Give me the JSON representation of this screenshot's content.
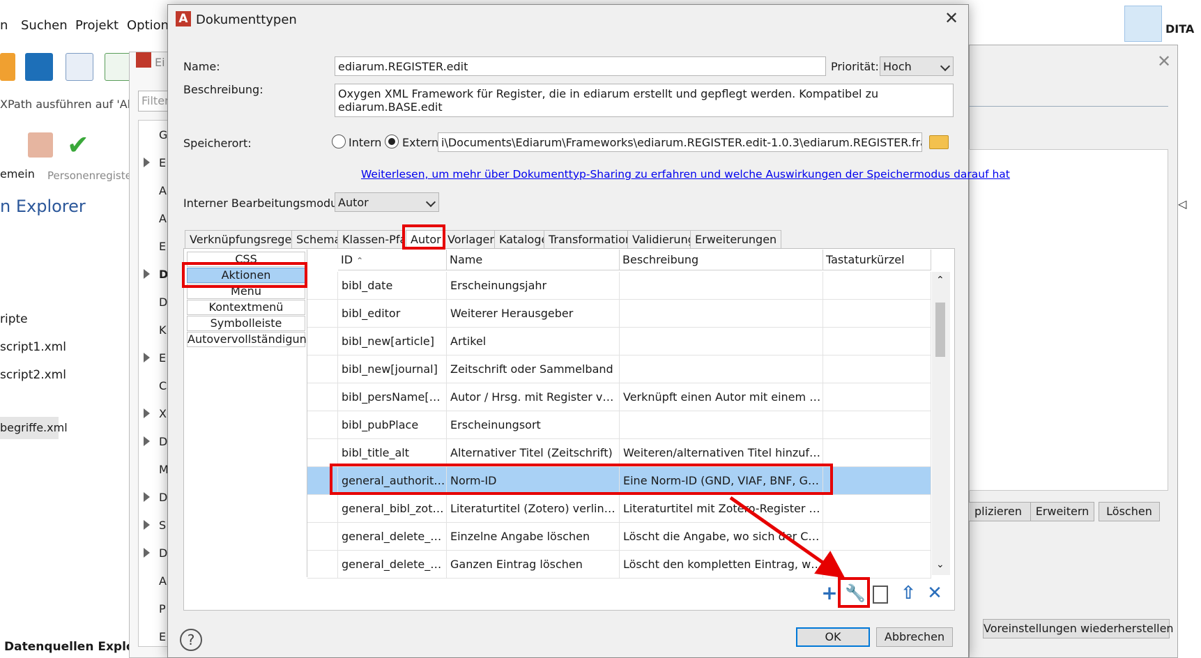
{
  "background_app": {
    "menu": [
      "n",
      "Suchen",
      "Projekt",
      "Option"
    ],
    "xpath_label": "XPath ausführen auf  'Ak",
    "filter_placeholder": "Filter",
    "toolbar_left_text": "emein",
    "toolbar_right_text": "Personenregister",
    "explorer_title": "n Explorer",
    "files": [
      "ripte",
      "script1.xml",
      "script2.xml",
      ""
    ],
    "selected_file": "begriffe.xml",
    "bottom_title": "Datenquellen Explorer",
    "inner_window_title": "Ei",
    "tree_letters": [
      "G",
      "E",
      "A",
      "A",
      "E",
      "D",
      "D",
      "K",
      "E",
      "C",
      "X",
      "D",
      "M",
      "D",
      "S",
      "D",
      "A",
      "P",
      "E"
    ],
    "right_buttons": {
      "duplicate": "plizieren",
      "extend": "Erweitern",
      "delete": "Löschen",
      "restore": "Voreinstellungen wiederherstellen"
    },
    "dita_label": "DITA"
  },
  "dialog": {
    "title": "Dokumenttypen",
    "name_label": "Name:",
    "name_value": "ediarum.REGISTER.edit",
    "priority_label": "Priorität:",
    "priority_value": "Hoch",
    "description_label": "Beschreibung:",
    "description_value": "Oxygen XML Framework für Register, die in ediarum erstellt und gepflegt werden. Kompatibel zu ediarum.BASE.edit",
    "storage_label": "Speicherort:",
    "storage_intern": "Intern",
    "storage_extern": "Extern",
    "storage_path": "i\\Documents\\Ediarum\\Frameworks\\ediarum.REGISTER.edit-1.0.3\\ediarum.REGISTER.framework",
    "info_link": "Weiterlesen, um mehr über Dokumenttyp-Sharing zu erfahren und welche Auswirkungen der Speichermodus darauf hat",
    "edit_mode_label": "Interner Bearbeitungsmodus:",
    "edit_mode_value": "Autor",
    "tabs": [
      "Verknüpfungsregeln",
      "Schema",
      "Klassen-Pfad",
      "Autor",
      "Vorlagen",
      "Kataloge",
      "Transformation",
      "Validierung",
      "Erweiterungen"
    ],
    "side_items": [
      "CSS",
      "Aktionen",
      "Menü",
      "Kontextmenü",
      "Symbolleiste",
      "Autovervollständigung"
    ],
    "columns": [
      "ID",
      "Name",
      "Beschreibung",
      "Tastaturkürzel"
    ],
    "rows": [
      [
        "bibl_date",
        "Erscheinungsjahr",
        "",
        ""
      ],
      [
        "bibl_editor",
        "Weiterer Herausgeber",
        "",
        ""
      ],
      [
        "bibl_new[article]",
        "Artikel",
        "",
        ""
      ],
      [
        "bibl_new[journal]",
        "Zeitschrift oder Sammelband",
        "",
        ""
      ],
      [
        "bibl_persName[key]",
        "Autor / Hrsg. mit Register verkn...",
        "Verknüpft einen Autor mit einem Eintr...",
        ""
      ],
      [
        "bibl_pubPlace",
        "Erscheinungsort",
        "",
        ""
      ],
      [
        "bibl_title_alt",
        "Alternativer Titel (Zeitschrift)",
        "Weiteren/alternativen Titel hinzufügen",
        ""
      ],
      [
        "general_authorityID",
        "Norm-ID",
        "Eine Norm-ID (GND, VIAF, BNF, GeoN...",
        ""
      ],
      [
        "general_bibl_zotero",
        "Literaturtitel (Zotero) verlinken",
        "Literaturtitel mit Zotero-Register verkn...",
        ""
      ],
      [
        "general_delete_ele...",
        "Einzelne Angabe löschen",
        "Löscht die Angabe, wo sich der Cursor...",
        ""
      ],
      [
        "general_delete_entry",
        "Ganzen Eintrag löschen",
        "Löscht den kompletten Eintrag, wo sic...",
        ""
      ]
    ],
    "ok_label": "OK",
    "cancel_label": "Abbrechen",
    "help_label": "?"
  },
  "colors": {
    "selection": "#a9d1f5",
    "highlight": "#e60000",
    "accent": "#2a6ebb"
  },
  "icons": [
    "add-icon",
    "wrench-icon",
    "copy-icon",
    "export-icon",
    "delete-icon",
    "folder-icon",
    "close-icon"
  ]
}
